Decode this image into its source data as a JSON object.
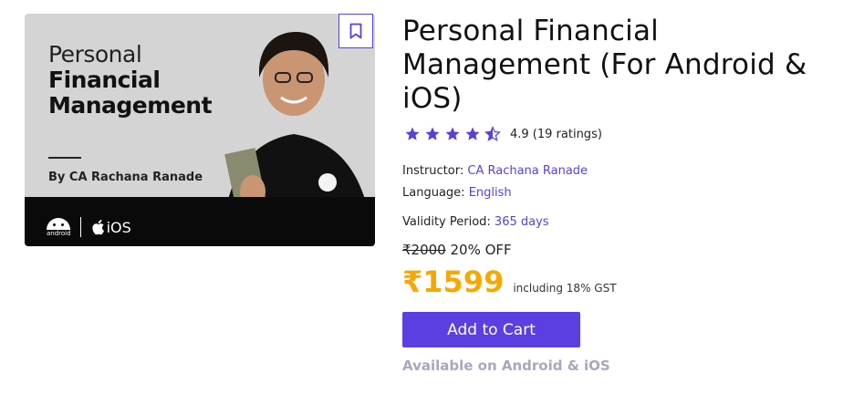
{
  "thumbnail": {
    "line1": "Personal",
    "line2": "Financial",
    "line3": "Management",
    "byline": "By CA Rachana Ranade",
    "android_label": "android",
    "ios_label": "iOS"
  },
  "course": {
    "title": "Personal Financial Management (For Android & iOS)",
    "rating_value": 4.5,
    "rating_text": "4.9 (19 ratings)",
    "instructor_label": "Instructor:",
    "instructor": "CA Rachana Ranade",
    "language_label": "Language:",
    "language": "English",
    "validity_label": "Validity Period:",
    "validity": "365 days"
  },
  "pricing": {
    "original": "₹2000",
    "discount": "20% OFF",
    "current": "₹1599",
    "tax_note": "including 18% GST"
  },
  "actions": {
    "add_to_cart": "Add to Cart",
    "availability": "Available on Android & iOS"
  },
  "colors": {
    "accent": "#5b3fe0",
    "price": "#f6a800",
    "muted": "#a6a8bd"
  },
  "icons": {
    "bookmark": "bookmark-icon",
    "star": "star-icon",
    "half_star": "half-star-icon"
  }
}
